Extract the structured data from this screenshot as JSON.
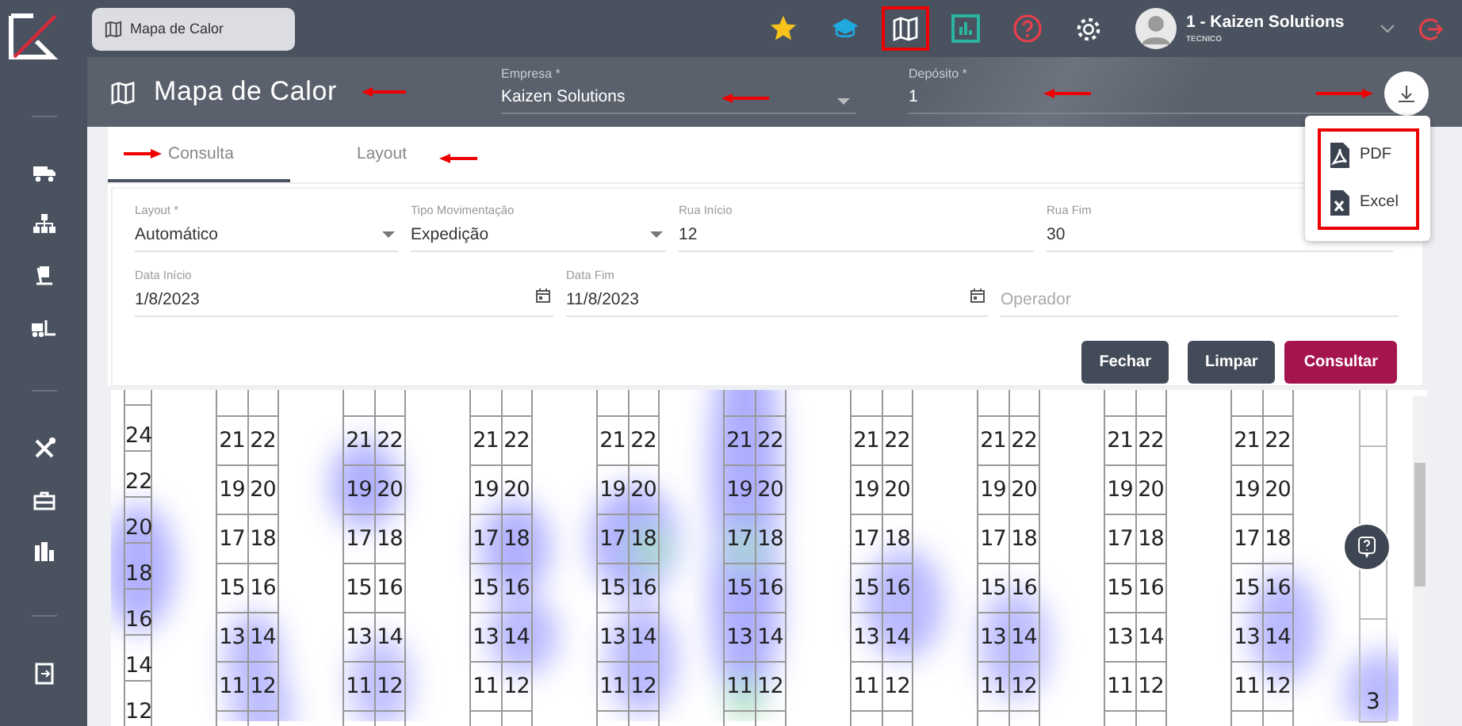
{
  "topbar": {
    "open_tab": "Mapa de Calor",
    "user": {
      "name": "1 - Kaizen Solutions",
      "role": "TECNICO"
    }
  },
  "header": {
    "title": "Mapa de Calor",
    "fields": [
      {
        "label": "Empresa *",
        "value": "Kaizen Solutions",
        "kind": "select"
      },
      {
        "label": "Depósito *",
        "value": "1",
        "kind": "text"
      }
    ]
  },
  "export_menu": {
    "items": [
      {
        "label": "PDF",
        "kind": "pdf"
      },
      {
        "label": "Excel",
        "kind": "excel"
      }
    ]
  },
  "tabs": [
    {
      "label": "Consulta",
      "selected": true
    },
    {
      "label": "Layout",
      "selected": false
    }
  ],
  "filters": [
    [
      {
        "label": "Layout *",
        "value": "Automático",
        "kind": "select"
      },
      {
        "label": "Tipo Movimentação",
        "value": "Expedição",
        "kind": "select"
      },
      {
        "label": "Rua Início",
        "value": "12",
        "kind": "text"
      },
      {
        "label": "Rua Fim",
        "value": "30",
        "kind": "text"
      }
    ],
    [
      {
        "label": "Data Início",
        "value": "1/8/2023",
        "kind": "date"
      },
      {
        "label": "Data Fim",
        "value": "11/8/2023",
        "kind": "date"
      },
      {
        "placeholder": "Operador",
        "kind": "text"
      }
    ]
  ],
  "buttons": [
    {
      "label": "Fechar",
      "kind": "secondary"
    },
    {
      "label": "Limpar",
      "kind": "secondary"
    },
    {
      "label": "Consultar",
      "kind": "primary"
    }
  ],
  "heat_map": {
    "left_column": [
      "24",
      "22",
      "20",
      "18",
      "16",
      "14",
      "12"
    ],
    "racks": [
      {
        "rows": [
          [
            "21",
            "22"
          ],
          [
            "19",
            "20"
          ],
          [
            "17",
            "18"
          ],
          [
            "15",
            "16"
          ],
          [
            "13",
            "14"
          ],
          [
            "11",
            "12"
          ]
        ]
      },
      {
        "rows": [
          [
            "21",
            "22"
          ],
          [
            "19",
            "20"
          ],
          [
            "17",
            "18"
          ],
          [
            "15",
            "16"
          ],
          [
            "13",
            "14"
          ],
          [
            "11",
            "12"
          ]
        ]
      },
      {
        "rows": [
          [
            "21",
            "22"
          ],
          [
            "19",
            "20"
          ],
          [
            "17",
            "18"
          ],
          [
            "15",
            "16"
          ],
          [
            "13",
            "14"
          ],
          [
            "11",
            "12"
          ]
        ]
      },
      {
        "rows": [
          [
            "21",
            "22"
          ],
          [
            "19",
            "20"
          ],
          [
            "17",
            "18"
          ],
          [
            "15",
            "16"
          ],
          [
            "13",
            "14"
          ],
          [
            "11",
            "12"
          ]
        ]
      },
      {
        "rows": [
          [
            "21",
            "22"
          ],
          [
            "19",
            "20"
          ],
          [
            "17",
            "18"
          ],
          [
            "15",
            "16"
          ],
          [
            "13",
            "14"
          ],
          [
            "11",
            "12"
          ]
        ]
      },
      {
        "rows": [
          [
            "21",
            "22"
          ],
          [
            "19",
            "20"
          ],
          [
            "17",
            "18"
          ],
          [
            "15",
            "16"
          ],
          [
            "13",
            "14"
          ],
          [
            "11",
            "12"
          ]
        ]
      },
      {
        "rows": [
          [
            "21",
            "22"
          ],
          [
            "19",
            "20"
          ],
          [
            "17",
            "18"
          ],
          [
            "15",
            "16"
          ],
          [
            "13",
            "14"
          ],
          [
            "11",
            "12"
          ]
        ]
      },
      {
        "rows": [
          [
            "21",
            "22"
          ],
          [
            "19",
            "20"
          ],
          [
            "17",
            "18"
          ],
          [
            "15",
            "16"
          ],
          [
            "13",
            "14"
          ],
          [
            "11",
            "12"
          ]
        ]
      },
      {
        "rows": [
          [
            "21",
            "22"
          ],
          [
            "19",
            "20"
          ],
          [
            "17",
            "18"
          ],
          [
            "15",
            "16"
          ],
          [
            "13",
            "14"
          ],
          [
            "11",
            "12"
          ]
        ]
      }
    ],
    "right_column": {
      "label": "3"
    }
  }
}
